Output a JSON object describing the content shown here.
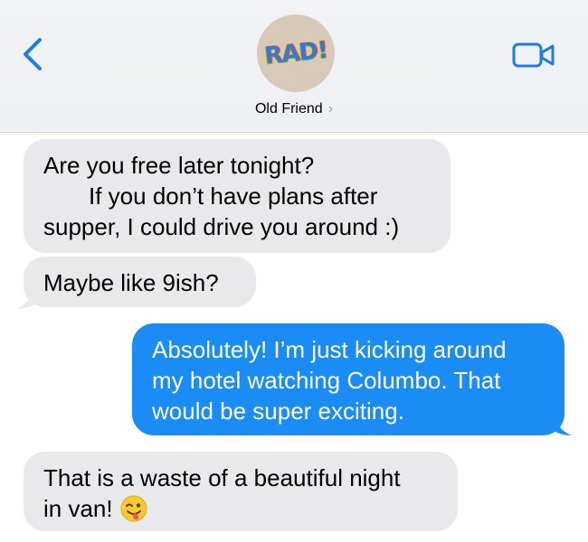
{
  "header": {
    "contact_name": "Old Friend",
    "chevron": "›",
    "avatar_text": "RAD!",
    "back_icon": "chevron-left-icon",
    "video_icon": "video-camera-icon",
    "accent": "#1b7cf0"
  },
  "messages": [
    {
      "direction": "incoming",
      "lines": [
        "Are you free later tonight?",
        "If you don’t have plans after",
        "supper, I could drive you around :)"
      ]
    },
    {
      "direction": "incoming",
      "lines": [
        "Maybe like 9ish?"
      ]
    },
    {
      "direction": "outgoing",
      "lines": [
        "Absolutely! I’m just kicking around",
        "my hotel watching Columbo. That",
        "would be super exciting."
      ]
    },
    {
      "direction": "incoming",
      "lines": [
        "That is a waste of a beautiful night",
        "in van!"
      ],
      "emoji": "winking-tongue-face-emoji"
    }
  ],
  "colors": {
    "incoming_bubble": "#e9e9eb",
    "outgoing_bubble": "#1b8cf6"
  }
}
